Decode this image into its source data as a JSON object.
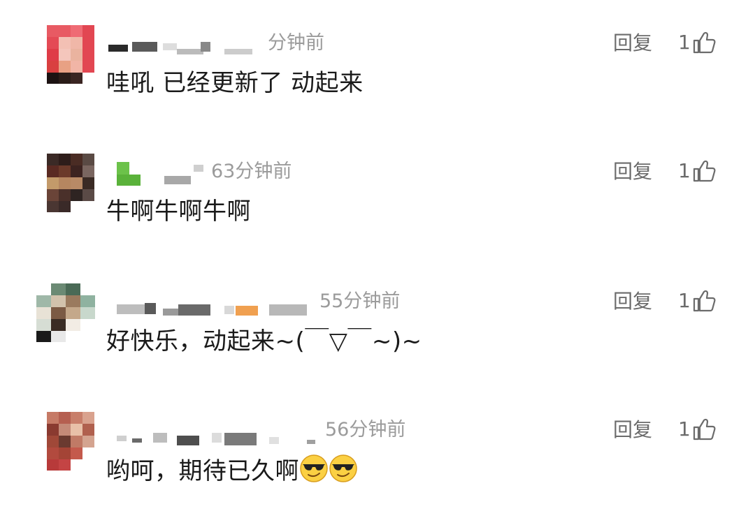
{
  "comments": [
    {
      "time": "分钟前",
      "content": "哇吼 已经更新了  动起来",
      "reply_label": "回复",
      "like_count": "1",
      "avatar_colors": [
        "#e85a63",
        "#e85a63",
        "#ef6b74",
        "#e24752",
        "#e44a55",
        "#f3c0b4",
        "#f0b7a8",
        "#e24752",
        "#df3c47",
        "#f4c6bc",
        "#eab39f",
        "#e24752",
        "#d94040",
        "#e8a184",
        "#f1b5a6",
        "#e24752",
        "#1c1212",
        "#2a1c18",
        "#3a2522",
        "#ffffff"
      ]
    },
    {
      "time": "63分钟前",
      "content": "牛啊牛啊牛啊",
      "reply_label": "回复",
      "like_count": "1",
      "avatar_colors": [
        "#3b2a26",
        "#2e1d1a",
        "#4a2c24",
        "#5a4a44",
        "#5a2a22",
        "#6b3a2a",
        "#3c2320",
        "#7a6660",
        "#c39a6a",
        "#b58660",
        "#b88a66",
        "#3a2a24",
        "#6a4438",
        "#4a302a",
        "#2e2422",
        "#5a4a46",
        "#4a3632",
        "#3a2a28",
        "#ffffff",
        "#ffffff"
      ]
    },
    {
      "time": "55分钟前",
      "content": "好快乐，动起来~(￣▽￣~)~",
      "reply_label": "回复",
      "like_count": "1",
      "avatar_colors": [
        "#ffffff",
        "#6b8a74",
        "#4a6a56",
        "#ffffff",
        "#9fb8a8",
        "#d2c2ac",
        "#9a7a5e",
        "#8fb2a0",
        "#e8e2d6",
        "#7b5a44",
        "#c4a88a",
        "#c8d8cc",
        "#d6ddd4",
        "#3a2c24",
        "#f2ece4",
        "#ffffff",
        "#1a1a1a",
        "#e8e8e8",
        "#ffffff",
        "#ffffff"
      ]
    },
    {
      "time": "56分钟前",
      "content": "哟呵，期待已久啊",
      "reply_label": "回复",
      "like_count": "1",
      "emojis": [
        "cool-sunglasses-emoji",
        "cool-sunglasses-emoji"
      ],
      "avatar_colors": [
        "#c67a66",
        "#b55f50",
        "#c87e6a",
        "#d9a28e",
        "#8a3a30",
        "#c48a78",
        "#e8c0a8",
        "#b0604e",
        "#a04838",
        "#6a3a30",
        "#c07a66",
        "#d4a490",
        "#b24a3e",
        "#a44436",
        "#c45a4c",
        "#ffffff",
        "#b83a3a",
        "#c44444",
        "#ffffff",
        "#ffffff"
      ]
    }
  ]
}
